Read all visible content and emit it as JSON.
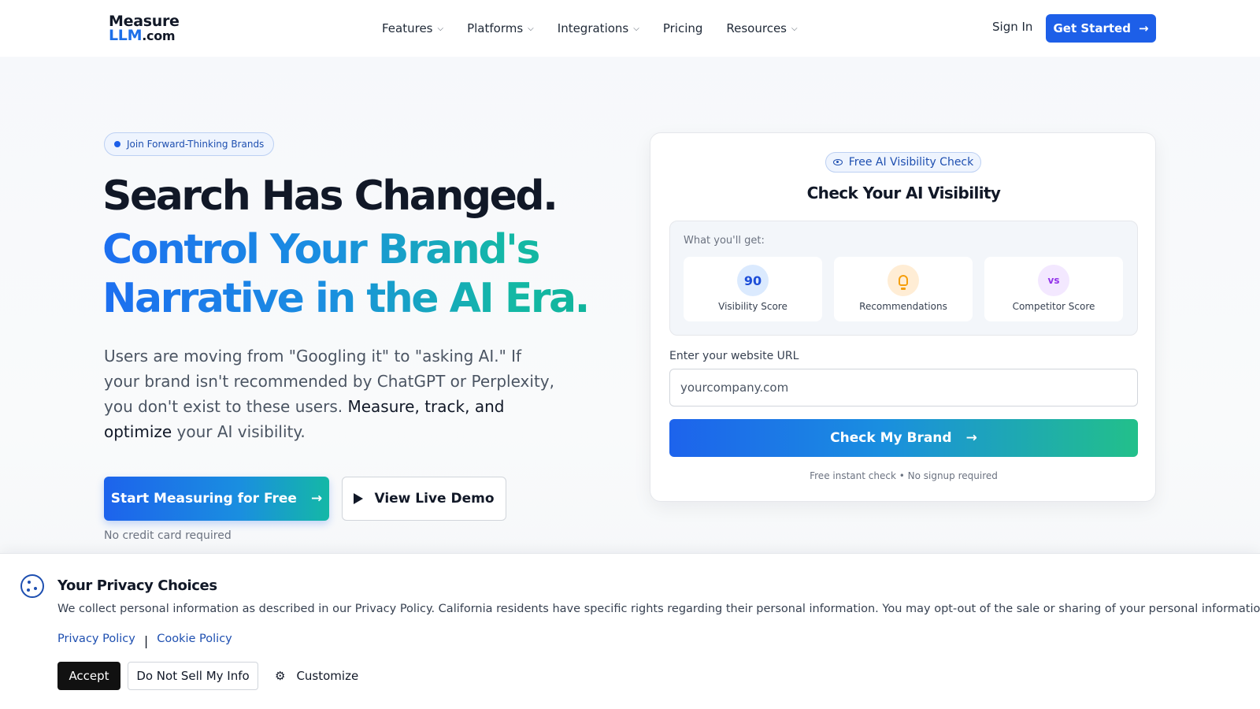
{
  "header": {
    "logo_line1": "Measure",
    "logo_line2": "LLM",
    "logo_suffix": ".com",
    "nav": [
      {
        "label": "Features",
        "has_dropdown": true
      },
      {
        "label": "Platforms",
        "has_dropdown": true
      },
      {
        "label": "Integrations",
        "has_dropdown": true
      },
      {
        "label": "Pricing",
        "has_dropdown": false
      },
      {
        "label": "Resources",
        "has_dropdown": true
      }
    ],
    "sign_in": "Sign In",
    "get_started": "Get Started"
  },
  "hero": {
    "badge": "Join Forward-Thinking Brands",
    "title": "Search Has Changed.",
    "subtitle_line1": "Control Your Brand's",
    "subtitle_line2": "Narrative in the AI Era.",
    "lead_part1": "Users are moving from \"Googling it\" to \"asking AI.\" If your brand isn't recommended by ChatGPT or Perplexity, you don't exist to these users. ",
    "lead_strong": "Measure, track, and optimize",
    "lead_part2": " your AI visibility.",
    "primary_cta": "Start Measuring for Free",
    "secondary_cta": "View Live Demo",
    "no_cc": "No credit card required"
  },
  "card": {
    "badge": "Free AI Visibility Check",
    "title": "Check Your AI Visibility",
    "benefits_label": "What you'll get:",
    "benefits": [
      {
        "icon_text": "90",
        "label": "Visibility Score"
      },
      {
        "icon": "lightbulb-icon",
        "label": "Recommendations"
      },
      {
        "icon_text": "vs",
        "label": "Competitor Score"
      }
    ],
    "url_label": "Enter your website URL",
    "url_placeholder": "yourcompany.com",
    "submit": "Check My Brand",
    "note": "Free instant check • No signup required"
  },
  "cookie": {
    "title": "Your Privacy Choices",
    "text": "We collect personal information as described in our Privacy Policy. California residents have specific rights regarding their personal information. You may opt-out of the sale or sharing of your personal information.",
    "privacy_link": "Privacy Policy",
    "separator": "|",
    "cookie_link": "Cookie Policy",
    "accept": "Accept",
    "do_not_sell": "Do Not Sell My Info",
    "customize": "Customize"
  },
  "colors": {
    "brand_blue": "#1d5fe8",
    "brand_teal": "#14b8a6",
    "text_dark": "#111827"
  }
}
